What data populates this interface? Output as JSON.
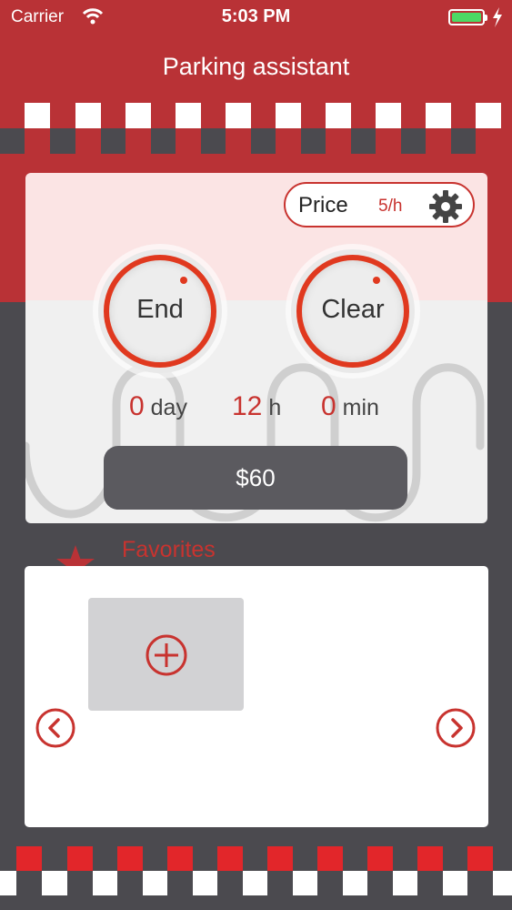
{
  "status_bar": {
    "carrier": "Carrier",
    "time": "5:03 PM"
  },
  "header": {
    "title": "Parking assistant"
  },
  "price": {
    "label": "Price",
    "rate": "5/h"
  },
  "buttons": {
    "end_label": "End",
    "clear_label": "Clear"
  },
  "duration": {
    "days": "0",
    "days_unit": "day",
    "hours": "12",
    "hours_unit": "h",
    "minutes": "0",
    "minutes_unit": "min"
  },
  "total": "$60",
  "favorites": {
    "title": "Favorites"
  },
  "colors": {
    "brand_red": "#b93236",
    "accent_red": "#c8332f",
    "ring_orange_red": "#e0391f",
    "dark_gray": "#4b4a4f"
  }
}
